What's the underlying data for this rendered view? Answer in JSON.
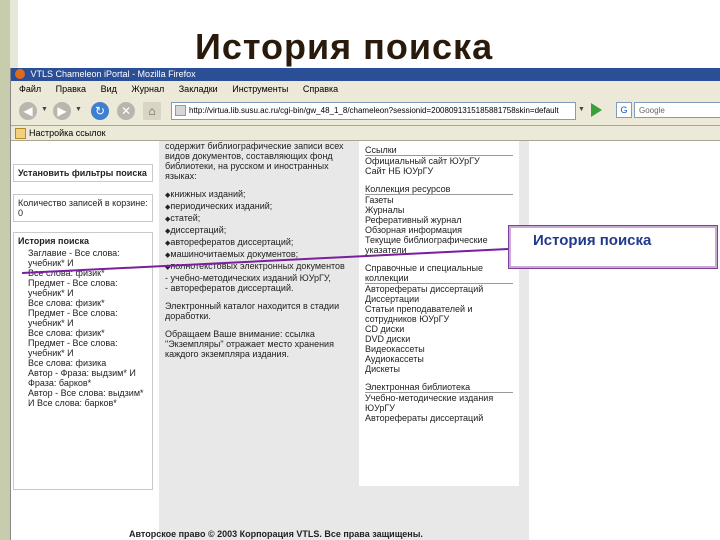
{
  "slide": {
    "title": "История поиска"
  },
  "browser": {
    "window_title": "VTLS Chameleon iPortal - Mozilla Firefox",
    "menu": [
      "Файл",
      "Правка",
      "Вид",
      "Журнал",
      "Закладки",
      "Инструменты",
      "Справка"
    ],
    "url": "http://virtua.lib.susu.ac.ru/cgi-bin/gw_48_1_8/chameleon?sessionid=2008091315185881758skin=default",
    "search_placeholder": "Google",
    "bookmark": "Настройка ссылок"
  },
  "left_panel": {
    "filter_box": "Установить фильтры поиска",
    "count_box": "Количество записей в корзине: 0",
    "history_title": "История поиска",
    "history_items": [
      "Заглавие - Все слова: учебник* И",
      "Все слова: физик*",
      "Предмет - Все слова: учебник* И",
      "Все слова: физик*",
      "Предмет - Все слова: учебник* И",
      "Все слова: физик*",
      "Предмет - Все слова: учебник* И",
      "Все слова: физика",
      "Автор - Фраза: выдзим* И Фраза: барков*",
      "Автор - Все слова: выдзим* И Все слова: барков*"
    ]
  },
  "middle_panel": {
    "intro": "содержит библиографические записи всех видов документов, составляющих фонд библиотеки, на русском и иностранных языках:",
    "bullets": [
      "книжных изданий;",
      "периодических изданий;",
      "статей;",
      "диссертаций;",
      "авторефератов диссертаций;",
      "машиночитаемых документов;",
      "полнотекстовых электронных документов"
    ],
    "extra": [
      "- учебно-методических изданий ЮУрГУ,",
      "- авторефератов диссертаций."
    ],
    "note": "Электронный каталог находится в стадии доработки.",
    "attention": "Обращаем Ваше внимание: ссылка \"Экземпляры\" отражает место хранения каждого экземпляра издания."
  },
  "right_panel": {
    "links_title": "Ссылки",
    "links": [
      "Официальный сайт ЮУрГУ",
      "Сайт НБ ЮУрГУ",
      "Коллекция ресурсов",
      "Газеты",
      "Журналы",
      "Реферативный журнал",
      "Обзорная информация",
      "Текущие библиографические указатели",
      "Справочные и специальные коллекции",
      "Авторефераты диссертаций",
      "Диссертации",
      "Статьи преподавателей и сотрудников ЮУрГУ",
      "CD диски",
      "DVD диски",
      "Видеокассеты",
      "Аудиокассеты",
      "Дискеты",
      "Электронная библиотека",
      "Учебно-методические издания ЮУрГУ",
      "Авторефераты диссертаций"
    ]
  },
  "footer": {
    "copyright": "Авторское право © 2003 Корпорация VTLS. Все права защищены."
  },
  "callout": {
    "label": "История поиска"
  },
  "colors": {
    "title_bar": "#2b4f96",
    "callout_border": "#7f3f98",
    "callout_text": "#203a8c",
    "connector": "#7a1fa0"
  }
}
